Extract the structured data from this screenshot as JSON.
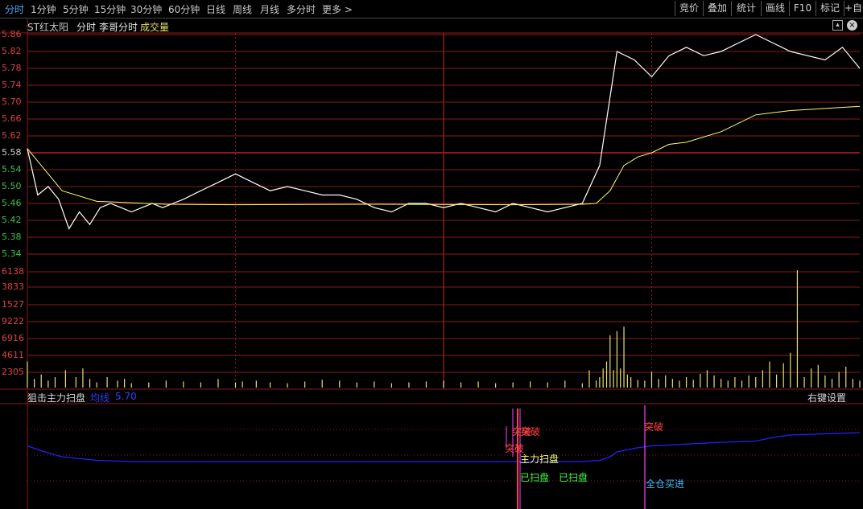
{
  "toolbar": {
    "tabs": [
      "分时",
      "1分钟",
      "5分钟",
      "15分钟",
      "30分钟",
      "60分钟",
      "日线",
      "周线",
      "月线",
      "多分时",
      "更多"
    ],
    "active_tab": "分时",
    "right_buttons": [
      "竞价",
      "叠加",
      "统计",
      "画线",
      "F10",
      "标记",
      "+自选"
    ]
  },
  "chart_header": {
    "stock_name": "ST红太阳",
    "mode_label": "分时",
    "formula_name": "李哥分时",
    "volume_label": "成交量"
  },
  "colors": {
    "price_line": "#ffffff",
    "avg_line": "#ffff66",
    "grid": "#8b1a1a",
    "axis_up": "#e04040",
    "axis_down": "#40c040",
    "volume_bar": "#e8e070",
    "indicator_line": "#2020ff",
    "signal_break": "#ff4040",
    "signal_main": "#ffff66",
    "signal_swept": "#40ff40",
    "signal_fullbuy": "#40c0ff",
    "signal_stem": "#ff40ff"
  },
  "chart_data": [
    {
      "type": "line",
      "title": "ST红太阳 分时",
      "preclose": 5.58,
      "ylim": [
        5.3,
        5.88
      ],
      "y_ticks": [
        5.86,
        5.82,
        5.78,
        5.74,
        5.7,
        5.66,
        5.62,
        5.58,
        5.54,
        5.5,
        5.46,
        5.42,
        5.38,
        5.34
      ],
      "series": [
        {
          "name": "price",
          "x": [
            0,
            3,
            6,
            9,
            12,
            15,
            18,
            21,
            24,
            27,
            30,
            33,
            36,
            39,
            42,
            45,
            50,
            55,
            60,
            65,
            70,
            75,
            80,
            85,
            90,
            95,
            100,
            105,
            110,
            115,
            120,
            125,
            130,
            135,
            140,
            145,
            150,
            155,
            160,
            165,
            170,
            175,
            180,
            185,
            190,
            195,
            200,
            205,
            210,
            215,
            220,
            225,
            230,
            235,
            240
          ],
          "values": [
            5.59,
            5.48,
            5.5,
            5.47,
            5.4,
            5.44,
            5.41,
            5.45,
            5.46,
            5.45,
            5.44,
            5.45,
            5.46,
            5.45,
            5.46,
            5.47,
            5.49,
            5.51,
            5.53,
            5.51,
            5.49,
            5.5,
            5.49,
            5.48,
            5.48,
            5.47,
            5.45,
            5.44,
            5.46,
            5.46,
            5.45,
            5.46,
            5.45,
            5.44,
            5.46,
            5.45,
            5.44,
            5.45,
            5.46,
            5.55,
            5.82,
            5.8,
            5.76,
            5.81,
            5.83,
            5.81,
            5.82,
            5.84,
            5.86,
            5.84,
            5.82,
            5.81,
            5.8,
            5.83,
            5.78
          ]
        },
        {
          "name": "avg",
          "x": [
            0,
            10,
            20,
            40,
            60,
            100,
            140,
            160,
            164,
            168,
            172,
            176,
            180,
            185,
            190,
            200,
            210,
            215,
            220,
            240
          ],
          "values": [
            5.59,
            5.49,
            5.465,
            5.458,
            5.457,
            5.458,
            5.457,
            5.458,
            5.46,
            5.49,
            5.55,
            5.57,
            5.58,
            5.6,
            5.605,
            5.63,
            5.67,
            5.675,
            5.68,
            5.69
          ]
        }
      ]
    },
    {
      "type": "bar",
      "title": "成交量",
      "y_ticks": [
        6138,
        3833,
        1527,
        9222,
        6916,
        4611,
        2305
      ],
      "x": [
        0,
        2,
        4,
        6,
        8,
        11,
        14,
        16,
        18,
        20,
        23,
        26,
        28,
        30,
        35,
        40,
        45,
        50,
        55,
        60,
        62,
        66,
        70,
        75,
        80,
        85,
        90,
        95,
        100,
        105,
        110,
        115,
        120,
        125,
        130,
        135,
        140,
        145,
        150,
        155,
        160,
        162,
        164,
        165,
        166,
        167,
        168,
        169,
        170,
        171,
        172,
        173,
        174,
        176,
        178,
        180,
        182,
        184,
        186,
        188,
        190,
        192,
        194,
        196,
        198,
        200,
        202,
        204,
        206,
        208,
        210,
        212,
        214,
        216,
        218,
        220,
        222,
        224,
        226,
        228,
        230,
        232,
        234,
        236,
        238,
        240
      ],
      "values": [
        30,
        10,
        15,
        8,
        12,
        20,
        12,
        22,
        10,
        6,
        12,
        8,
        10,
        5,
        6,
        8,
        7,
        6,
        10,
        6,
        7,
        8,
        6,
        5,
        7,
        9,
        8,
        6,
        7,
        5,
        6,
        7,
        8,
        6,
        7,
        5,
        6,
        7,
        6,
        8,
        5,
        20,
        8,
        12,
        22,
        30,
        60,
        20,
        65,
        22,
        70,
        15,
        12,
        9,
        8,
        18,
        10,
        14,
        10,
        8,
        12,
        9,
        16,
        20,
        14,
        10,
        8,
        12,
        8,
        14,
        12,
        20,
        30,
        15,
        28,
        40,
        135,
        12,
        22,
        26,
        14,
        10,
        18,
        24,
        10,
        8,
        14,
        10,
        16,
        12
      ]
    },
    {
      "type": "line",
      "title": "狙击主力扫盘",
      "series": [
        {
          "name": "均线",
          "x": [
            0,
            5,
            10,
            20,
            30,
            60,
            100,
            140,
            160,
            165,
            168,
            170,
            175,
            180,
            200,
            210,
            215,
            220,
            240
          ],
          "values": [
            5.59,
            5.54,
            5.5,
            5.47,
            5.46,
            5.46,
            5.46,
            5.46,
            5.46,
            5.47,
            5.5,
            5.54,
            5.57,
            5.59,
            5.62,
            5.63,
            5.66,
            5.68,
            5.7
          ]
        }
      ]
    }
  ],
  "indicator": {
    "title": "狙击主力扫盘",
    "avg_label": "均线",
    "avg_value": "5.70",
    "right_label": "右键设置"
  },
  "signals": {
    "break1": "突破",
    "break2": "突破",
    "break3": "突破",
    "main_sweep": "主力扫盘",
    "swept1": "已扫盘",
    "swept2": "已扫盘",
    "full_buy": "全仓买进"
  }
}
